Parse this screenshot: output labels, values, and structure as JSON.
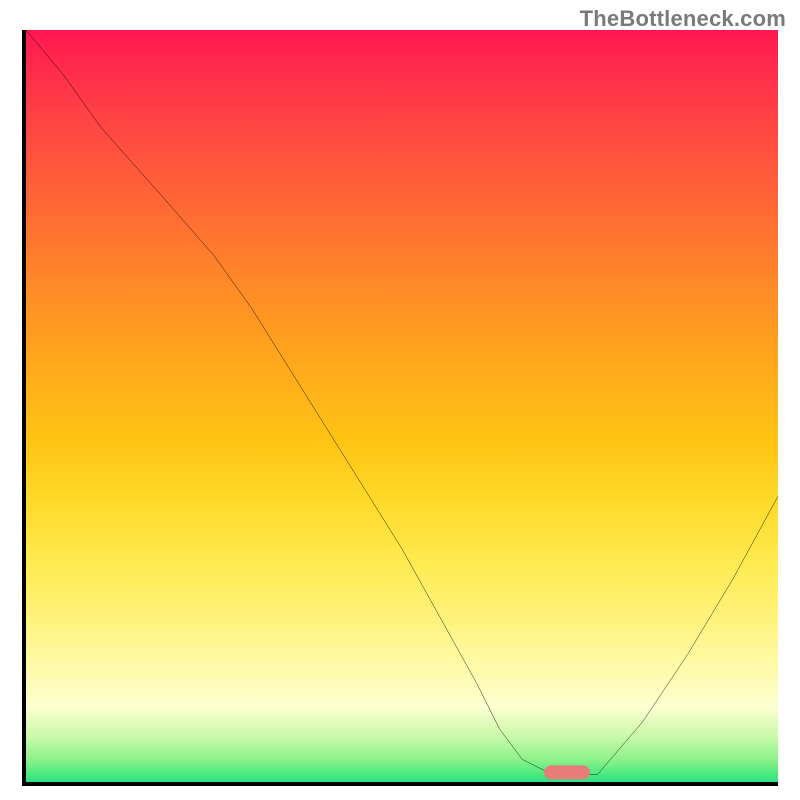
{
  "watermark": "TheBottleneck.com",
  "chart_data": {
    "type": "line",
    "title": "",
    "xlabel": "",
    "ylabel": "",
    "xlim": [
      0,
      100
    ],
    "ylim": [
      0,
      100
    ],
    "grid": false,
    "legend": false,
    "series": [
      {
        "name": "bottleneck-curve",
        "color": "#000000",
        "x": [
          0,
          5,
          10,
          18,
          25,
          30,
          35,
          40,
          45,
          50,
          55,
          60,
          63,
          66,
          70,
          76,
          82,
          88,
          94,
          100
        ],
        "values": [
          100,
          94,
          87,
          78,
          70,
          63,
          55,
          47,
          39,
          31,
          22,
          13,
          7,
          3,
          1,
          1,
          8,
          17,
          27,
          38
        ]
      }
    ],
    "marker": {
      "label": "optimal-range",
      "x": 72,
      "y": 0.5,
      "color": "#e77c79"
    },
    "background": {
      "type": "vertical-gradient",
      "stops": [
        {
          "pos": 0,
          "color": "#ff1752"
        },
        {
          "pos": 24,
          "color": "#ff6a34"
        },
        {
          "pos": 54,
          "color": "#ffc214"
        },
        {
          "pos": 78,
          "color": "#fff27a"
        },
        {
          "pos": 94,
          "color": "#c8f9a9"
        },
        {
          "pos": 100,
          "color": "#2de085"
        }
      ]
    }
  }
}
